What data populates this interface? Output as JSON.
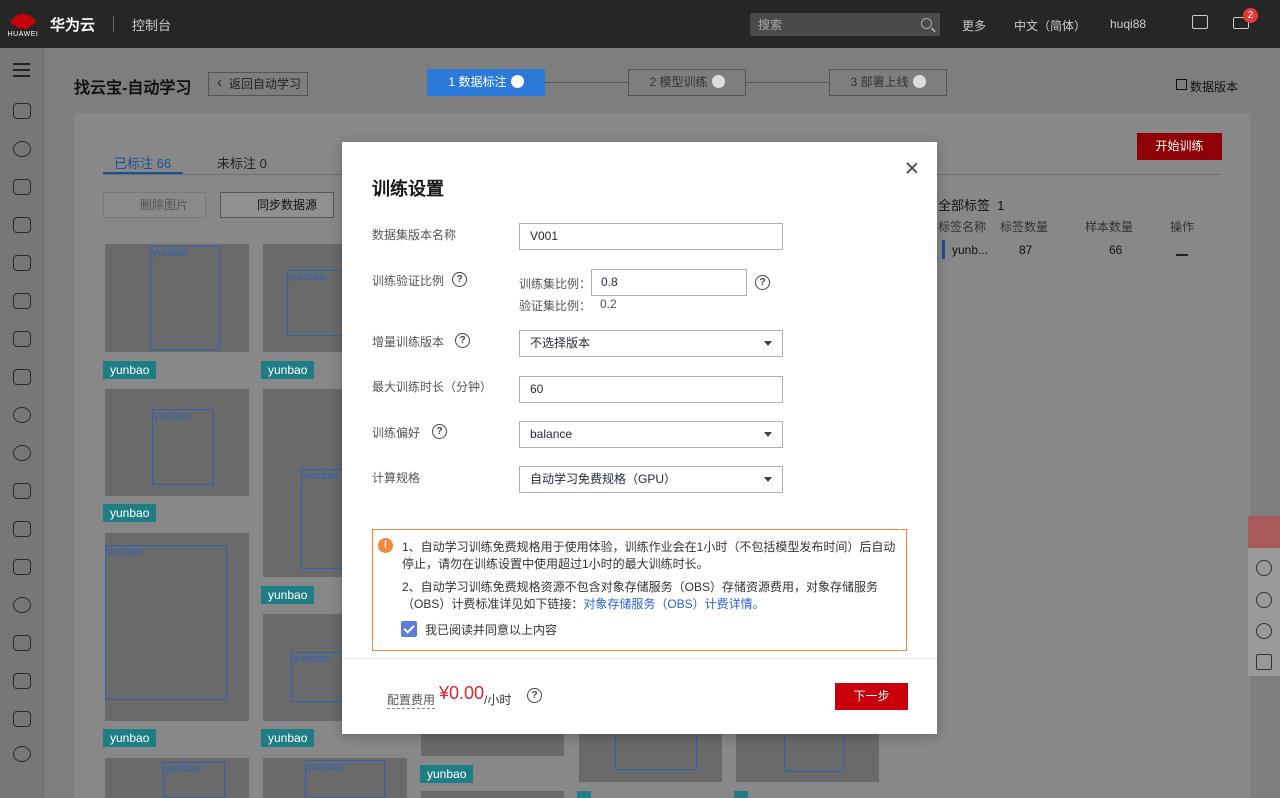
{
  "topbar": {
    "logo_text": "HUAWEI",
    "brand": "华为云",
    "console": "控制台",
    "search_placeholder": "搜索",
    "more": "更多",
    "language": "中文（简体）",
    "user": "huqi88",
    "notification_count": "2"
  },
  "page": {
    "title": "找云宝-自动学习",
    "back_label": "返回自动学习",
    "steps": [
      {
        "label": "1 数据标注"
      },
      {
        "label": "2 模型训练"
      },
      {
        "label": "3 部署上线"
      }
    ],
    "version_link": "数据版本"
  },
  "dataset": {
    "tab_labeled": "已标注 66",
    "tab_unlabeled": "未标注 0",
    "start_training": "开始训练",
    "delete_images": "删除图片",
    "sync_source": "同步数据源",
    "box_label": "yunbao",
    "tag": "yunbao",
    "all_labels_title": "全部标签",
    "all_labels_count": "1",
    "label_table": {
      "headers": [
        "标签名称",
        "标签数量",
        "样本数量",
        "操作"
      ],
      "row": {
        "name": "yunb...",
        "label_count": "87",
        "sample_count": "66"
      }
    }
  },
  "modal": {
    "title": "训练设置",
    "fields": {
      "dataset_version_label": "数据集版本名称",
      "dataset_version_value": "V001",
      "ratio_label": "训练验证比例",
      "train_ratio_label": "训练集比例：",
      "train_ratio_value": "0.8",
      "val_ratio_label": "验证集比例：",
      "val_ratio_value": "0.2",
      "incremental_label": "增量训练版本",
      "incremental_value": "不选择版本",
      "max_duration_label": "最大训练时长（分钟）",
      "max_duration_value": "60",
      "preference_label": "训练偏好",
      "preference_value": "balance",
      "spec_label": "计算规格",
      "spec_value": "自动学习免费规格（GPU）"
    },
    "notice": {
      "line1": "1、自动学习训练免费规格用于使用体验，训练作业会在1小时（不包括模型发布时间）后自动停止，请勿在训练设置中使用超过1小时的最大训练时长。",
      "line2_prefix": "2、自动学习训练免费规格资源不包含对象存储服务（OBS）存储资源费用，对象存储服务（OBS）计费标准详见如下链接：",
      "line2_link": "对象存储服务（OBS）计费详情。",
      "agree": "我已阅读并同意以上内容"
    },
    "footer": {
      "cost_label": "配置费用",
      "cost_amount": "¥0.00",
      "cost_unit": "/小时",
      "next_button": "下一步"
    }
  }
}
